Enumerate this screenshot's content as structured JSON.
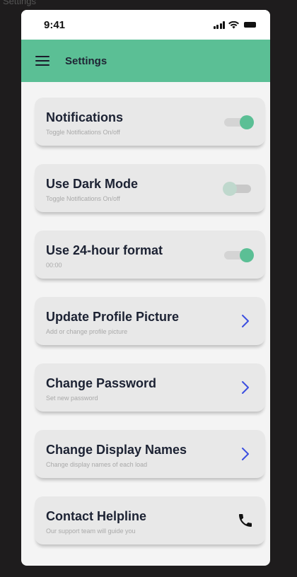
{
  "frame": {
    "label": "Settings"
  },
  "status_bar": {
    "time": "9:41"
  },
  "app_bar": {
    "title": "Settings"
  },
  "items": [
    {
      "title": "Notifications",
      "subtitle": "Toggle Notifications  On/off",
      "control": "toggle",
      "on": true
    },
    {
      "title": "Use Dark Mode",
      "subtitle": "Toggle Notifications  On/off",
      "control": "toggle",
      "on": false
    },
    {
      "title": "Use 24-hour format",
      "subtitle": "00:00",
      "control": "toggle",
      "on": true
    },
    {
      "title": "Update Profile Picture",
      "subtitle": "Add or change profile picture",
      "control": "chevron-right-icon"
    },
    {
      "title": "Change Password",
      "subtitle": "Set new password",
      "control": "chevron-right-icon"
    },
    {
      "title": "Change Display Names",
      "subtitle": "Change display names of each load",
      "control": "chevron-right-icon"
    },
    {
      "title": "Contact Helpline",
      "subtitle": "Our support team will guide you",
      "control": "phone-icon"
    }
  ],
  "colors": {
    "accent": "#5bbf95",
    "title_text": "#1c2233",
    "chevron": "#3c4fe0"
  }
}
